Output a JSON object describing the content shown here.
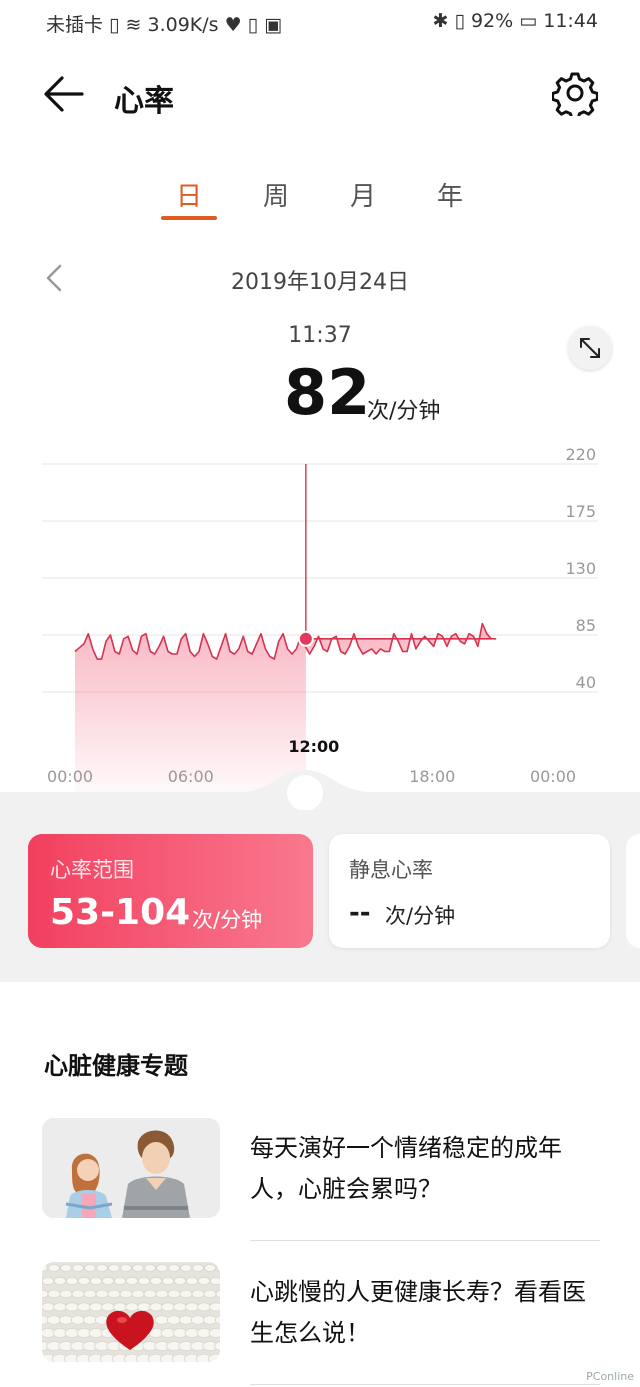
{
  "status_bar": {
    "left": "未插卡 ▯ ≋ 3.09K/s ♥ ▯ ▣",
    "right": "✱ ▯ 92% ▭ 11:44"
  },
  "header": {
    "title": "心率"
  },
  "tabs": [
    {
      "label": "日",
      "active": true
    },
    {
      "label": "周",
      "active": false
    },
    {
      "label": "月",
      "active": false
    },
    {
      "label": "年",
      "active": false
    }
  ],
  "date": "2019年10月24日",
  "current": {
    "time": "11:37",
    "value": "82",
    "unit": "次/分钟"
  },
  "chart_data": {
    "type": "area",
    "y_ticks": [
      "220",
      "175",
      "130",
      "85",
      "40"
    ],
    "x_ticks": [
      "00:00",
      "06:00",
      "12:00",
      "18:00",
      "00:00"
    ],
    "highlight_x_label": "12:00",
    "ylim": [
      40,
      220
    ],
    "x_start_hour": 0.15,
    "x_hour_step": 0.22,
    "y": [
      72,
      75,
      78,
      86,
      74,
      66,
      66,
      80,
      85,
      72,
      70,
      82,
      84,
      73,
      70,
      84,
      86,
      72,
      70,
      76,
      84,
      72,
      70,
      70,
      82,
      86,
      72,
      68,
      72,
      86,
      78,
      68,
      66,
      76,
      86,
      72,
      70,
      74,
      84,
      72,
      70,
      78,
      86,
      74,
      68,
      66,
      80,
      86,
      74,
      70,
      74,
      84,
      76,
      70,
      76,
      84,
      74,
      72,
      82,
      84,
      72,
      70,
      76,
      86,
      76,
      70,
      72,
      74,
      70,
      74,
      72,
      72,
      86,
      80,
      72,
      72,
      86,
      74,
      80,
      84,
      80,
      76,
      86,
      84,
      76,
      84,
      86,
      80,
      78,
      86,
      84,
      76,
      94,
      86,
      82,
      82
    ],
    "spike": {
      "hour": 11.62,
      "value": 220
    },
    "selected": {
      "hour": 11.62,
      "value": 82
    }
  },
  "cards": {
    "range": {
      "label": "心率范围",
      "value": "53-104",
      "unit": "次/分钟"
    },
    "resting": {
      "label": "静息心率",
      "value": "--",
      "unit": "次/分钟"
    }
  },
  "section": {
    "title": "心脏健康专题",
    "articles": [
      {
        "title": "每天演好一个情绪稳定的成年人，心脏会累吗？"
      },
      {
        "title": "心跳慢的人更健康长寿？看看医生怎么说！"
      }
    ]
  },
  "watermark": "PConline",
  "colors": {
    "accent": "#e05a23",
    "heart": "#e23a5c",
    "card_gradient_start": "#f2405f",
    "card_gradient_end": "#f9788e"
  }
}
